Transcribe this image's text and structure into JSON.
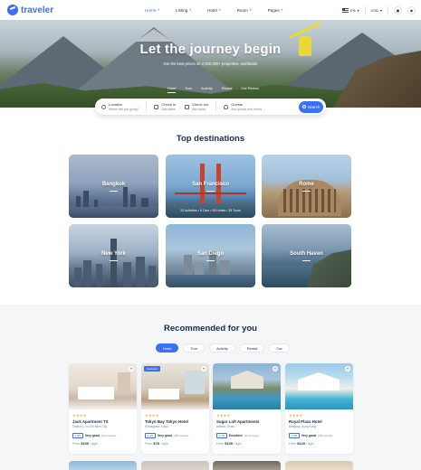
{
  "brand": {
    "name": "traveler",
    "color": "#3b6ff5"
  },
  "nav": {
    "items": [
      {
        "label": "Home",
        "active": true
      },
      {
        "label": "Listing",
        "active": false
      },
      {
        "label": "Hotel",
        "active": false
      },
      {
        "label": "Room",
        "active": false
      },
      {
        "label": "Pages",
        "active": false
      }
    ],
    "language": "EN",
    "currency": "USD"
  },
  "hero": {
    "title": "Let the journey begin",
    "subtitle": "Get the best prices on 2,000,000+ properties, worldwide",
    "tabs": [
      {
        "label": "Hotel",
        "active": true
      },
      {
        "label": "Tour",
        "active": false
      },
      {
        "label": "Activity",
        "active": false
      },
      {
        "label": "Rental",
        "active": false
      },
      {
        "label": "Car Rental",
        "active": false
      }
    ]
  },
  "search": {
    "location": {
      "label": "Location",
      "placeholder": "Where are you going?"
    },
    "check_in": {
      "label": "Check in",
      "placeholder": "Add dates"
    },
    "check_out": {
      "label": "Check out",
      "placeholder": "Add dates"
    },
    "guests": {
      "label": "Guests",
      "placeholder": "Add guests and rooms"
    },
    "button": "Search"
  },
  "destinations": {
    "title": "Top destinations",
    "items": [
      {
        "name": "Bangkok"
      },
      {
        "name": "San Francisco",
        "meta": "22 Activities • 6 Cars • 25 Hotels • 25 Tours"
      },
      {
        "name": "Rome"
      },
      {
        "name": "New York"
      },
      {
        "name": "San Diego"
      },
      {
        "name": "South Haven"
      }
    ]
  },
  "recommended": {
    "title": "Recommended for you",
    "tabs": [
      {
        "label": "Hotel",
        "active": true
      },
      {
        "label": "Tour",
        "active": false
      },
      {
        "label": "Activity",
        "active": false
      },
      {
        "label": "Rental",
        "active": false
      },
      {
        "label": "Car",
        "active": false
      }
    ],
    "cards": [
      {
        "title": "Jack Apartment TS",
        "location": "District 1, Ho Chi Minh City",
        "stars": "★★★★",
        "score": "4.5/5",
        "word": "Very good",
        "reviews": "(20 reviews)",
        "price_prefix": "From:",
        "price": "$100",
        "unit": "/ night",
        "featured": false
      },
      {
        "title": "Tokyo Bay Tokyo Hotel",
        "location": "Shinagawa, Tokyo",
        "stars": "★★★★",
        "score": "4.3/5",
        "word": "Very good",
        "reviews": "(28 reviews)",
        "price_prefix": "From:",
        "price": "$78",
        "unit": "/ night",
        "featured": true,
        "featured_label": "Featured"
      },
      {
        "title": "Sugar Loft Apartments",
        "location": "Atlanta, Texas",
        "stars": "★★★★",
        "score": "4.7/5",
        "word": "Excellent",
        "reviews": "(32 reviews)",
        "price_prefix": "From:",
        "price": "$100",
        "unit": "/ night",
        "featured": false
      },
      {
        "title": "Royal Plaza Hotel",
        "location": "Bangkok, Hong Kong",
        "stars": "★★★★",
        "score": "4.5/5",
        "word": "Very good",
        "reviews": "(28 reviews)",
        "price_prefix": "From:",
        "price": "$120",
        "unit": "/ night",
        "featured": false
      }
    ]
  }
}
